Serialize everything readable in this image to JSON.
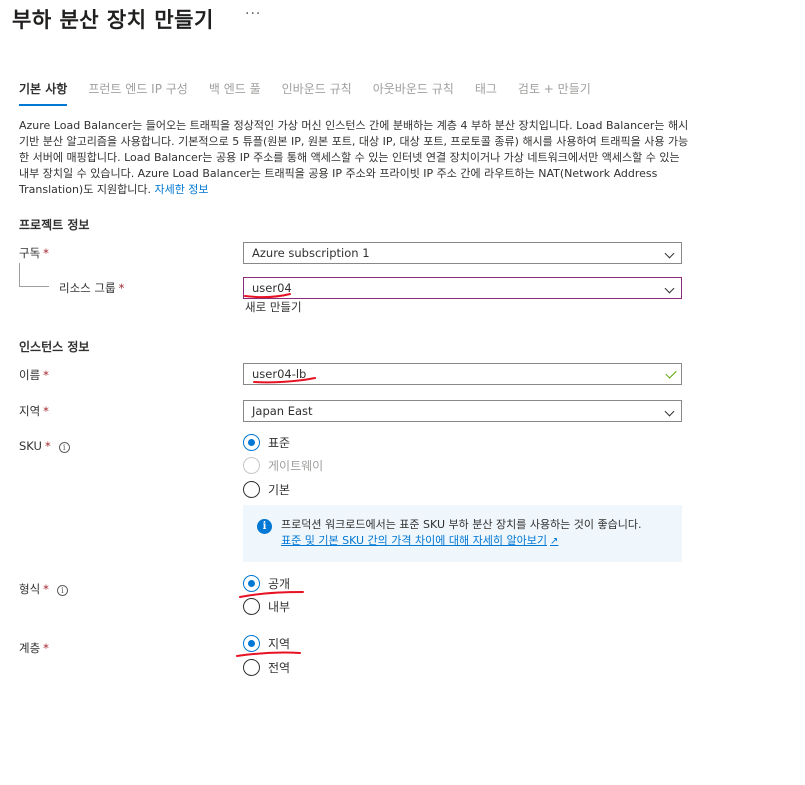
{
  "header": {
    "title": "부하 분산 장치 만들기",
    "more": "···"
  },
  "tabs": [
    {
      "label": "기본 사항",
      "active": true
    },
    {
      "label": "프런트 엔드 IP 구성"
    },
    {
      "label": "백 엔드 풀"
    },
    {
      "label": "인바운드 규칙"
    },
    {
      "label": "아웃바운드 규칙"
    },
    {
      "label": "태그"
    },
    {
      "label": "검토 + 만들기"
    }
  ],
  "intro": {
    "text": "Azure Load Balancer는 들어오는 트래픽을 정상적인 가상 머신 인스턴스 간에 분배하는 계층 4 부하 분산 장치입니다. Load Balancer는 해시 기반 분산 알고리즘을 사용합니다. 기본적으로 5 튜플(원본 IP, 원본 포트, 대상 IP, 대상 포트, 프로토콜 종류) 해시를 사용하여 트래픽을 사용 가능한 서버에 매핑합니다. Load Balancer는 공용 IP 주소를 통해 액세스할 수 있는 인터넷 연결 장치이거나 가상 네트워크에서만 액세스할 수 있는 내부 장치일 수 있습니다. Azure Load Balancer는 트래픽을 공용 IP 주소와 프라이빗 IP 주소 간에 라우트하는 NAT(Network Address Translation)도 지원합니다.",
    "link": "자세한 정보"
  },
  "project": {
    "heading": "프로젝트 정보",
    "subscription_label": "구독",
    "subscription_value": "Azure subscription 1",
    "rg_label": "리소스 그룹",
    "rg_value": "user04",
    "rg_create": "새로 만들기"
  },
  "instance": {
    "heading": "인스턴스 정보",
    "name_label": "이름",
    "name_value": "user04-lb",
    "region_label": "지역",
    "region_value": "Japan East",
    "sku_label": "SKU",
    "sku_options": [
      "표준",
      "게이트웨이",
      "기본"
    ],
    "sku_selected": "표준",
    "info_text": "프로덕션 워크로드에서는 표준 SKU 부하 분산 장치를 사용하는 것이 좋습니다.",
    "info_link": "표준 및 기본 SKU 간의 가격 차이에 대해 자세히 알아보기",
    "type_label": "형식",
    "type_options": [
      "공개",
      "내부"
    ],
    "type_selected": "공개",
    "tier_label": "계층",
    "tier_options": [
      "지역",
      "전역"
    ],
    "tier_selected": "지역"
  },
  "required_mark": "*",
  "colors": {
    "accent": "#0078d4",
    "required": "#a4262c",
    "annotation": "#e81123",
    "focus_border": "#8b2b77",
    "valid": "#57a300"
  }
}
